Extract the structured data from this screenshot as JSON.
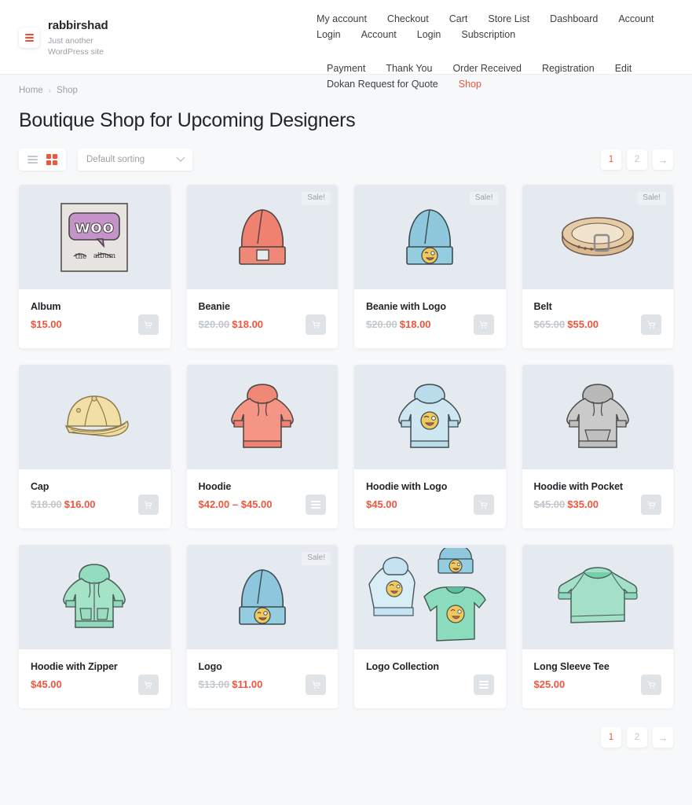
{
  "header": {
    "site_title": "rabbirshad",
    "tagline": "Just another WordPress site",
    "logo_icon": "lines-logo-icon",
    "nav_row1": [
      {
        "label": "My account",
        "active": false
      },
      {
        "label": "Checkout",
        "active": false
      },
      {
        "label": "Cart",
        "active": false
      },
      {
        "label": "Store List",
        "active": false
      },
      {
        "label": "Dashboard",
        "active": false
      },
      {
        "label": "Account",
        "active": false
      },
      {
        "label": "Login",
        "active": false
      },
      {
        "label": "Account",
        "active": false
      },
      {
        "label": "Login",
        "active": false
      },
      {
        "label": "Subscription",
        "active": false
      }
    ],
    "nav_row2": [
      {
        "label": "Payment",
        "active": false
      },
      {
        "label": "Thank You",
        "active": false
      },
      {
        "label": "Order Received",
        "active": false
      },
      {
        "label": "Registration",
        "active": false
      },
      {
        "label": "Edit",
        "active": false
      },
      {
        "label": "Dokan Request for Quote",
        "active": false
      },
      {
        "label": "Shop",
        "active": true
      }
    ]
  },
  "breadcrumb": {
    "home": "Home",
    "separator": "›",
    "current": "Shop"
  },
  "page_title": "Boutique Shop for Upcoming Designers",
  "toolbar": {
    "list_view_icon": "list-view-icon",
    "grid_view_icon": "grid-view-icon",
    "sorting_value": "Default sorting",
    "sorting_placeholder": "Default sorting"
  },
  "pagination": {
    "pages": [
      "1",
      "2"
    ],
    "current": "1",
    "next_symbol": "→"
  },
  "colors": {
    "accent": "#f0553d",
    "price": "#f0553d",
    "old_price": "#c3c8cd",
    "page_bg": "#f7f8f9",
    "thumb_bg": "#e4eaef",
    "text": "#22262a",
    "muted": "#9aa0a6"
  },
  "sale_badge_label": "Sale!",
  "products": [
    {
      "name": "Album",
      "price": "$15.00",
      "old_price": "",
      "sale": false,
      "action_icon": "cart-icon",
      "art": "album"
    },
    {
      "name": "Beanie",
      "price": "$18.00",
      "old_price": "$20.00",
      "sale": true,
      "action_icon": "cart-icon",
      "art": "beanie-red"
    },
    {
      "name": "Beanie with Logo",
      "price": "$18.00",
      "old_price": "$20.00",
      "sale": true,
      "action_icon": "cart-icon",
      "art": "beanie-blue-logo"
    },
    {
      "name": "Belt",
      "price": "$55.00",
      "old_price": "$65.00",
      "sale": true,
      "action_icon": "cart-icon",
      "art": "belt"
    },
    {
      "name": "Cap",
      "price": "$16.00",
      "old_price": "$18.00",
      "sale": false,
      "action_icon": "cart-icon",
      "art": "cap"
    },
    {
      "name": "Hoodie",
      "price": "$42.00 – $45.00",
      "old_price": "",
      "sale": false,
      "action_icon": "select-options-icon",
      "art": "hoodie-red"
    },
    {
      "name": "Hoodie with Logo",
      "price": "$45.00",
      "old_price": "",
      "sale": false,
      "action_icon": "cart-icon",
      "art": "hoodie-blue-logo"
    },
    {
      "name": "Hoodie with Pocket",
      "price": "$35.00",
      "old_price": "$45.00",
      "sale": false,
      "action_icon": "cart-icon",
      "art": "hoodie-gray"
    },
    {
      "name": "Hoodie with Zipper",
      "price": "$45.00",
      "old_price": "",
      "sale": false,
      "action_icon": "cart-icon",
      "art": "hoodie-zip-green"
    },
    {
      "name": "Logo",
      "price": "$11.00",
      "old_price": "$13.00",
      "sale": true,
      "action_icon": "cart-icon",
      "art": "beanie-blue-logo2"
    },
    {
      "name": "Logo Collection",
      "price": "",
      "old_price": "",
      "sale": false,
      "action_icon": "select-options-icon",
      "art": "logo-collection"
    },
    {
      "name": "Long Sleeve Tee",
      "price": "$25.00",
      "old_price": "",
      "sale": false,
      "action_icon": "cart-icon",
      "art": "longsleeve-green"
    }
  ]
}
